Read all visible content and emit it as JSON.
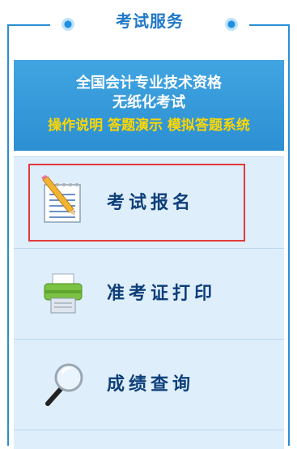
{
  "header": {
    "title": "考试服务"
  },
  "banner": {
    "line1": "全国会计专业技术资格",
    "line2": "无纸化考试",
    "line3": "操作说明 答题演示 模拟答题系统"
  },
  "items": [
    {
      "label": "考试报名",
      "icon": "notepad-pencil-icon",
      "highlighted": true
    },
    {
      "label": "准考证打印",
      "icon": "printer-icon",
      "highlighted": false
    },
    {
      "label": "成绩查询",
      "icon": "magnifier-icon",
      "highlighted": false
    }
  ],
  "colors": {
    "accent": "#2a8ed6",
    "banner_text_highlight": "#ffd700",
    "highlight_box": "#e23a3a"
  }
}
